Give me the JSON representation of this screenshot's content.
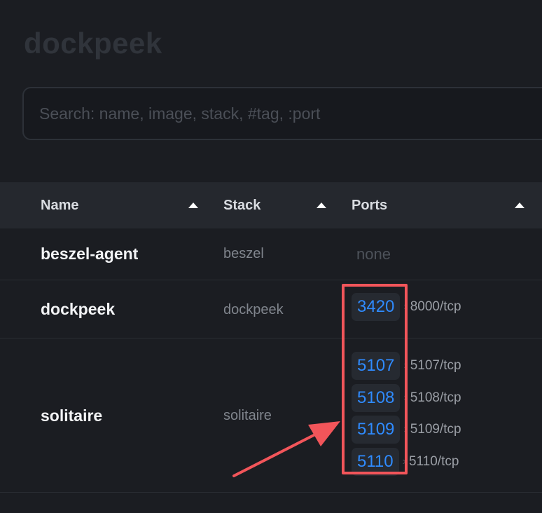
{
  "app": {
    "title": "dockpeek"
  },
  "search": {
    "placeholder": "Search: name, image, stack, #tag, :port"
  },
  "table": {
    "columns": [
      {
        "label": "Name"
      },
      {
        "label": "Stack"
      },
      {
        "label": "Ports"
      }
    ],
    "rows": [
      {
        "name": "beszel-agent",
        "stack": "beszel",
        "ports_empty": "none",
        "ports": []
      },
      {
        "name": "dockpeek",
        "stack": "dockpeek",
        "ports": [
          {
            "host": "3420",
            "container": "8000/tcp"
          }
        ]
      },
      {
        "name": "solitaire",
        "stack": "solitaire",
        "ports": [
          {
            "host": "5107",
            "container": "5107/tcp"
          },
          {
            "host": "5108",
            "container": "5108/tcp"
          },
          {
            "host": "5109",
            "container": "5109/tcp"
          },
          {
            "host": "5110",
            "container": "5110/tcp"
          }
        ]
      }
    ]
  },
  "icons": {
    "sort": "sort-ascending-icon",
    "port_arrow": "chevron-right-icon"
  },
  "colors": {
    "background": "#1b1d22",
    "header_background": "#25282e",
    "port_link": "#2f8bff",
    "port_chip": "#262a31",
    "annotation": "#f2555a"
  }
}
